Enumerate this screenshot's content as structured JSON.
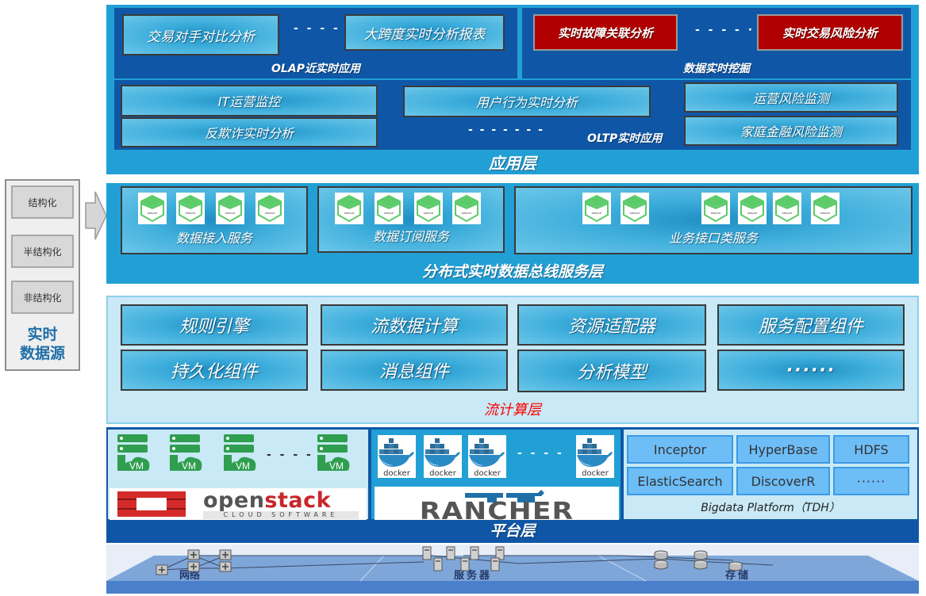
{
  "app_layer": {
    "title": "应用层",
    "olap": {
      "title": "OLAP近实时应用",
      "items": [
        "交易对手对比分析",
        "大跨度实时分析报表"
      ],
      "ellipsis": "- - - - ·"
    },
    "mining": {
      "title": "数据实时挖掘",
      "items": [
        "实时故障关联分析",
        "实时交易风险分析"
      ],
      "ellipsis": "- - - - ·"
    },
    "oltp": {
      "title": "OLTP实时应用",
      "items": [
        "IT运营监控",
        "反欺诈实时分析",
        "用户行为实时分析",
        "运营风险监测",
        "家庭金融风险监测"
      ],
      "ellipsis": "- - - - - - -"
    }
  },
  "bus_layer": {
    "title": "分布式实时数据总线服务层",
    "service_icon_label": "SERVICE",
    "groups": [
      {
        "label": "数据接入服务",
        "icon_count": 4
      },
      {
        "label": "数据订阅服务",
        "icon_count": 4
      },
      {
        "label": "业务接口类服务",
        "icon_count": 6
      }
    ]
  },
  "data_source": {
    "title_line1": "实时",
    "title_line2": "数据源",
    "items": [
      "结构化",
      "半结构化",
      "非结构化"
    ]
  },
  "stream_layer": {
    "title": "流计算层",
    "title_color": "#ff0000",
    "items": [
      "规则引擎",
      "流数据计算",
      "资源适配器",
      "服务配置组件",
      "持久化组件",
      "消息组件",
      "分析模型",
      "······"
    ]
  },
  "platform_layer": {
    "title": "平台层",
    "openstack": {
      "vm_label": "VM",
      "logo_word1": "open",
      "logo_word2": "stack",
      "logo_sub": "CLOUD SOFTWARE",
      "ellipsis": "- - - -"
    },
    "rancher": {
      "docker_label": "docker",
      "logo": "RANCHER",
      "ellipsis": "- - - -"
    },
    "bigdata": {
      "title": "Bigdata Platform（TDH）",
      "cells": [
        "Inceptor",
        "HyperBase",
        "HDFS",
        "ElasticSearch",
        "DiscoverR",
        "······"
      ]
    }
  },
  "infra_layer": {
    "labels": [
      "网络",
      "服务器",
      "存储"
    ]
  },
  "colors": {
    "app_bg": "#22a0d6",
    "app_inner": "#0f57a6",
    "stream_bg": "#c8e9f5",
    "platform_bg": "#0f57a6",
    "mining_red": "#b00000"
  }
}
